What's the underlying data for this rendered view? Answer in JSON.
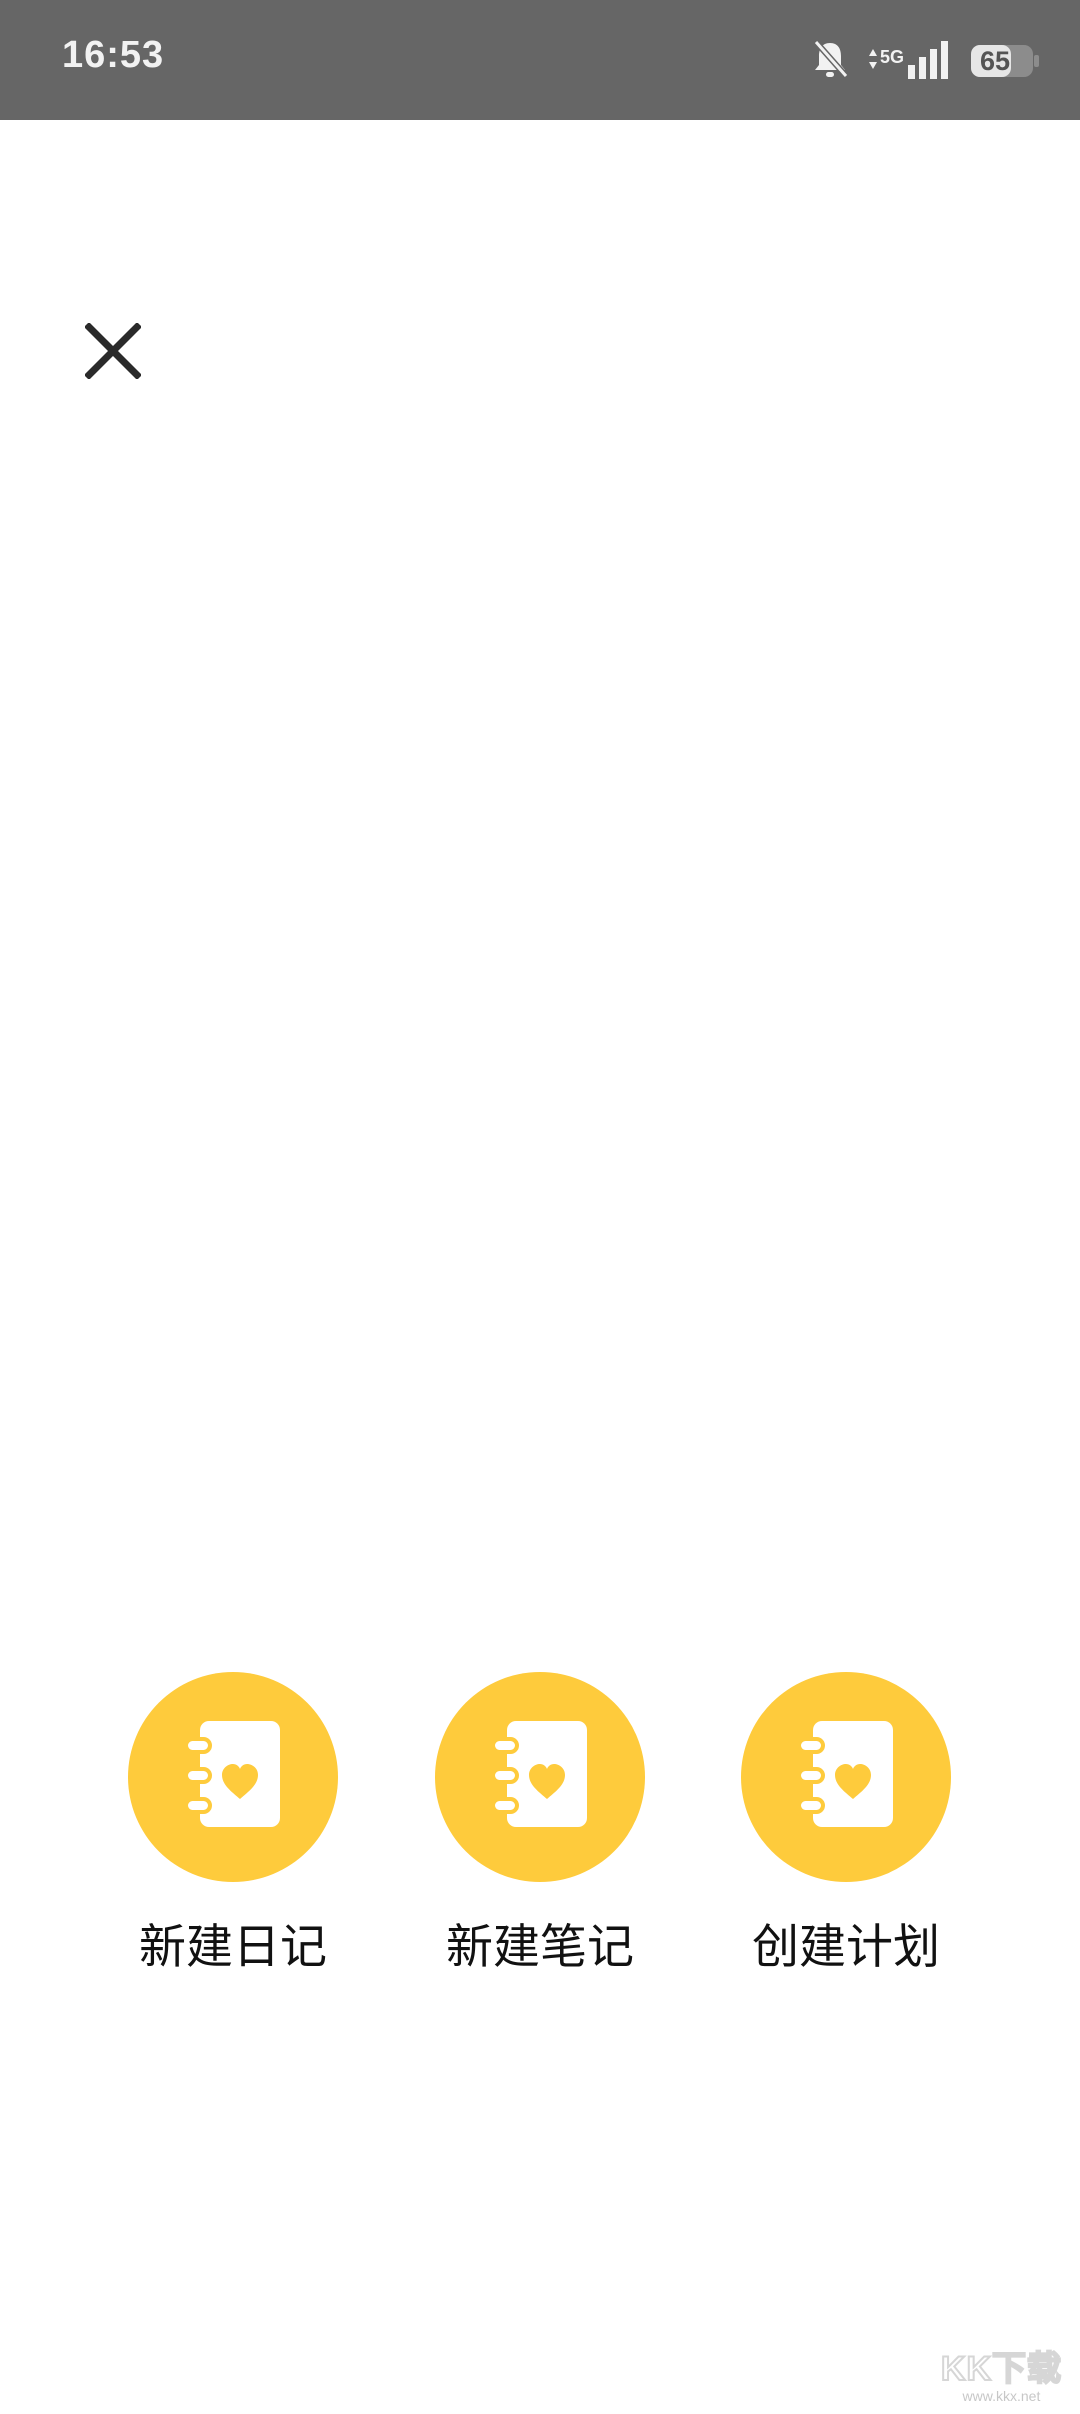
{
  "status_bar": {
    "time": "16:53",
    "network": "5G",
    "battery": "65",
    "icons": [
      "bell-muted-icon",
      "network-arrows-icon",
      "signal-bars-icon",
      "battery-icon"
    ]
  },
  "close_button": {
    "icon": "close-icon",
    "color": "#2a2a2a"
  },
  "actions": [
    {
      "label": "新建日记",
      "icon": "diary-heart-icon"
    },
    {
      "label": "新建笔记",
      "icon": "diary-heart-icon"
    },
    {
      "label": "创建计划",
      "icon": "diary-heart-icon"
    }
  ],
  "colors": {
    "accent": "#fecb3c",
    "status_bar_bg": "#666666",
    "background": "#ffffff"
  },
  "watermark": {
    "brand": "KK下载",
    "url": "www.kkx.net"
  }
}
